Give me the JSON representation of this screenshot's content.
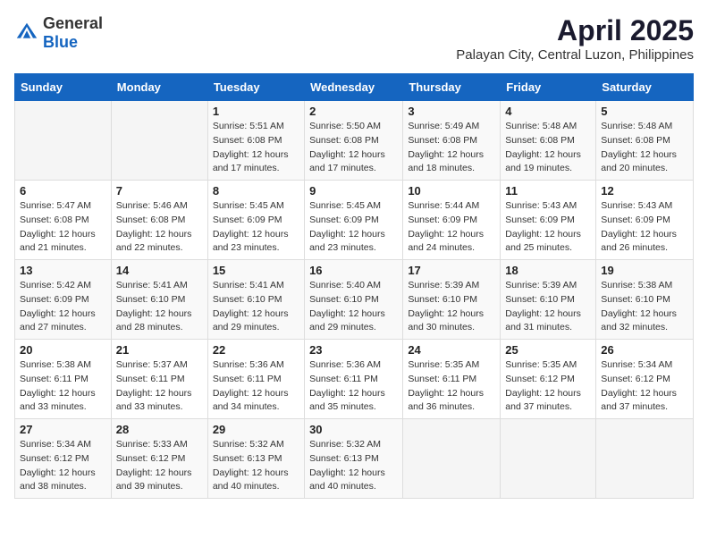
{
  "logo": {
    "general": "General",
    "blue": "Blue"
  },
  "header": {
    "title": "April 2025",
    "subtitle": "Palayan City, Central Luzon, Philippines"
  },
  "weekdays": [
    "Sunday",
    "Monday",
    "Tuesday",
    "Wednesday",
    "Thursday",
    "Friday",
    "Saturday"
  ],
  "weeks": [
    [
      {
        "day": "",
        "sunrise": "",
        "sunset": "",
        "daylight": ""
      },
      {
        "day": "",
        "sunrise": "",
        "sunset": "",
        "daylight": ""
      },
      {
        "day": "1",
        "sunrise": "Sunrise: 5:51 AM",
        "sunset": "Sunset: 6:08 PM",
        "daylight": "Daylight: 12 hours and 17 minutes."
      },
      {
        "day": "2",
        "sunrise": "Sunrise: 5:50 AM",
        "sunset": "Sunset: 6:08 PM",
        "daylight": "Daylight: 12 hours and 17 minutes."
      },
      {
        "day": "3",
        "sunrise": "Sunrise: 5:49 AM",
        "sunset": "Sunset: 6:08 PM",
        "daylight": "Daylight: 12 hours and 18 minutes."
      },
      {
        "day": "4",
        "sunrise": "Sunrise: 5:48 AM",
        "sunset": "Sunset: 6:08 PM",
        "daylight": "Daylight: 12 hours and 19 minutes."
      },
      {
        "day": "5",
        "sunrise": "Sunrise: 5:48 AM",
        "sunset": "Sunset: 6:08 PM",
        "daylight": "Daylight: 12 hours and 20 minutes."
      }
    ],
    [
      {
        "day": "6",
        "sunrise": "Sunrise: 5:47 AM",
        "sunset": "Sunset: 6:08 PM",
        "daylight": "Daylight: 12 hours and 21 minutes."
      },
      {
        "day": "7",
        "sunrise": "Sunrise: 5:46 AM",
        "sunset": "Sunset: 6:08 PM",
        "daylight": "Daylight: 12 hours and 22 minutes."
      },
      {
        "day": "8",
        "sunrise": "Sunrise: 5:45 AM",
        "sunset": "Sunset: 6:09 PM",
        "daylight": "Daylight: 12 hours and 23 minutes."
      },
      {
        "day": "9",
        "sunrise": "Sunrise: 5:45 AM",
        "sunset": "Sunset: 6:09 PM",
        "daylight": "Daylight: 12 hours and 23 minutes."
      },
      {
        "day": "10",
        "sunrise": "Sunrise: 5:44 AM",
        "sunset": "Sunset: 6:09 PM",
        "daylight": "Daylight: 12 hours and 24 minutes."
      },
      {
        "day": "11",
        "sunrise": "Sunrise: 5:43 AM",
        "sunset": "Sunset: 6:09 PM",
        "daylight": "Daylight: 12 hours and 25 minutes."
      },
      {
        "day": "12",
        "sunrise": "Sunrise: 5:43 AM",
        "sunset": "Sunset: 6:09 PM",
        "daylight": "Daylight: 12 hours and 26 minutes."
      }
    ],
    [
      {
        "day": "13",
        "sunrise": "Sunrise: 5:42 AM",
        "sunset": "Sunset: 6:09 PM",
        "daylight": "Daylight: 12 hours and 27 minutes."
      },
      {
        "day": "14",
        "sunrise": "Sunrise: 5:41 AM",
        "sunset": "Sunset: 6:10 PM",
        "daylight": "Daylight: 12 hours and 28 minutes."
      },
      {
        "day": "15",
        "sunrise": "Sunrise: 5:41 AM",
        "sunset": "Sunset: 6:10 PM",
        "daylight": "Daylight: 12 hours and 29 minutes."
      },
      {
        "day": "16",
        "sunrise": "Sunrise: 5:40 AM",
        "sunset": "Sunset: 6:10 PM",
        "daylight": "Daylight: 12 hours and 29 minutes."
      },
      {
        "day": "17",
        "sunrise": "Sunrise: 5:39 AM",
        "sunset": "Sunset: 6:10 PM",
        "daylight": "Daylight: 12 hours and 30 minutes."
      },
      {
        "day": "18",
        "sunrise": "Sunrise: 5:39 AM",
        "sunset": "Sunset: 6:10 PM",
        "daylight": "Daylight: 12 hours and 31 minutes."
      },
      {
        "day": "19",
        "sunrise": "Sunrise: 5:38 AM",
        "sunset": "Sunset: 6:10 PM",
        "daylight": "Daylight: 12 hours and 32 minutes."
      }
    ],
    [
      {
        "day": "20",
        "sunrise": "Sunrise: 5:38 AM",
        "sunset": "Sunset: 6:11 PM",
        "daylight": "Daylight: 12 hours and 33 minutes."
      },
      {
        "day": "21",
        "sunrise": "Sunrise: 5:37 AM",
        "sunset": "Sunset: 6:11 PM",
        "daylight": "Daylight: 12 hours and 33 minutes."
      },
      {
        "day": "22",
        "sunrise": "Sunrise: 5:36 AM",
        "sunset": "Sunset: 6:11 PM",
        "daylight": "Daylight: 12 hours and 34 minutes."
      },
      {
        "day": "23",
        "sunrise": "Sunrise: 5:36 AM",
        "sunset": "Sunset: 6:11 PM",
        "daylight": "Daylight: 12 hours and 35 minutes."
      },
      {
        "day": "24",
        "sunrise": "Sunrise: 5:35 AM",
        "sunset": "Sunset: 6:11 PM",
        "daylight": "Daylight: 12 hours and 36 minutes."
      },
      {
        "day": "25",
        "sunrise": "Sunrise: 5:35 AM",
        "sunset": "Sunset: 6:12 PM",
        "daylight": "Daylight: 12 hours and 37 minutes."
      },
      {
        "day": "26",
        "sunrise": "Sunrise: 5:34 AM",
        "sunset": "Sunset: 6:12 PM",
        "daylight": "Daylight: 12 hours and 37 minutes."
      }
    ],
    [
      {
        "day": "27",
        "sunrise": "Sunrise: 5:34 AM",
        "sunset": "Sunset: 6:12 PM",
        "daylight": "Daylight: 12 hours and 38 minutes."
      },
      {
        "day": "28",
        "sunrise": "Sunrise: 5:33 AM",
        "sunset": "Sunset: 6:12 PM",
        "daylight": "Daylight: 12 hours and 39 minutes."
      },
      {
        "day": "29",
        "sunrise": "Sunrise: 5:32 AM",
        "sunset": "Sunset: 6:13 PM",
        "daylight": "Daylight: 12 hours and 40 minutes."
      },
      {
        "day": "30",
        "sunrise": "Sunrise: 5:32 AM",
        "sunset": "Sunset: 6:13 PM",
        "daylight": "Daylight: 12 hours and 40 minutes."
      },
      {
        "day": "",
        "sunrise": "",
        "sunset": "",
        "daylight": ""
      },
      {
        "day": "",
        "sunrise": "",
        "sunset": "",
        "daylight": ""
      },
      {
        "day": "",
        "sunrise": "",
        "sunset": "",
        "daylight": ""
      }
    ]
  ]
}
